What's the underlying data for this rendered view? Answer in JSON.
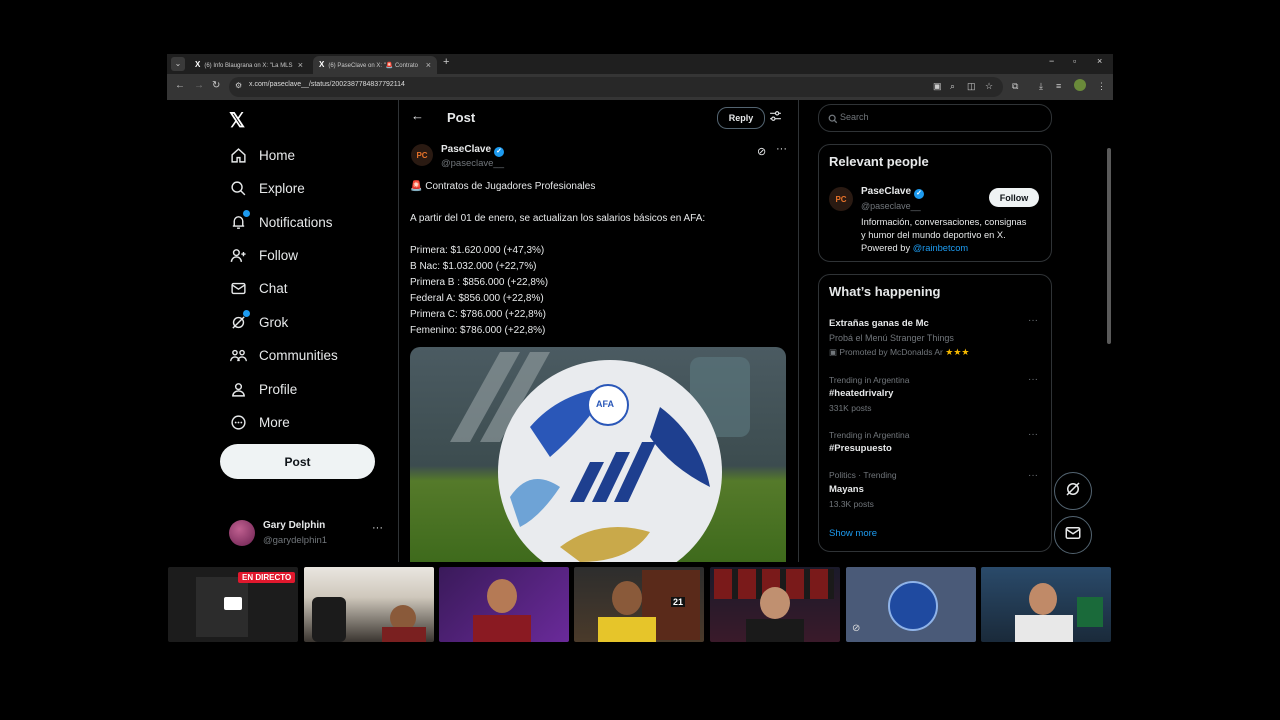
{
  "browser": {
    "tabs": [
      {
        "favicon": "X",
        "title": "(6) Info Blaugrana on X: \"La MLS",
        "close": "×"
      },
      {
        "favicon": "X",
        "title": "(6) PaseClave on X: \"🚨 Contrato",
        "close": "×"
      }
    ],
    "new_tab": "+",
    "window_controls": {
      "minimize": "−",
      "maximize": "▫",
      "close": "×"
    },
    "url": "x.com/paseclave__/status/2002387784837792114"
  },
  "sidebar": {
    "logo": "𝕏",
    "items": [
      {
        "label": "Home",
        "icon": "home-icon"
      },
      {
        "label": "Explore",
        "icon": "search-icon"
      },
      {
        "label": "Notifications",
        "icon": "bell-icon"
      },
      {
        "label": "Follow",
        "icon": "add-user-icon"
      },
      {
        "label": "Chat",
        "icon": "mail-icon"
      },
      {
        "label": "Grok",
        "icon": "grok-icon"
      },
      {
        "label": "Communities",
        "icon": "communities-icon"
      },
      {
        "label": "Profile",
        "icon": "person-icon"
      },
      {
        "label": "More",
        "icon": "more-circle-icon"
      }
    ],
    "post_button": "Post",
    "account": {
      "name": "Gary Delphin",
      "handle": "@garydelphin1",
      "more": "···"
    }
  },
  "main": {
    "header": {
      "back": "←",
      "title": "Post",
      "reply_button": "Reply"
    },
    "post": {
      "author_name": "PaseClave",
      "author_handle": "@paseclave__",
      "avatar_text": "PC",
      "more": "···",
      "lines": [
        "🚨 Contratos de Jugadores Profesionales",
        "A partir del 01 de enero, se actualizan los salarios básicos en AFA:",
        "Primera: $1.620.000 (+47,3%)",
        "B Nac: $1.032.000 (+22,7%)",
        "Primera B : $856.000 (+22,8%)",
        "Federal A: $856.000 (+22,8%)",
        "Primera C: $786.000 (+22,8%)",
        "Femenino: $786.000 (+22,8%)"
      ],
      "image_badge": "AFA"
    }
  },
  "right": {
    "search_placeholder": "Search",
    "relevant_people": {
      "title": "Relevant people",
      "name": "PaseClave",
      "handle": "@paseclave__",
      "follow": "Follow",
      "bio_lines": [
        "Información, conversaciones, consignas",
        "y humor del mundo deportivo en X."
      ],
      "bio_powered": "Powered by ",
      "bio_link": "@rainbetcom"
    },
    "whats_happening": {
      "title": "What’s happening",
      "trends": [
        {
          "name": "Extrañas ganas de Mc",
          "sub": "Probá el Menú Stranger Things",
          "promo": "Promoted by McDonalds Ar",
          "stars": "★★★"
        },
        {
          "context": "Trending in Argentina",
          "name": "#heatedrivalry",
          "count": "331K posts"
        },
        {
          "context": "Trending in Argentina",
          "name": "#Presupuesto"
        },
        {
          "context": "Politics · Trending",
          "name": "Mayans",
          "count": "13.3K posts"
        }
      ],
      "trend_more": "···",
      "show_more": "Show more"
    }
  },
  "video_strip": {
    "live_label": "EN DIRECTO",
    "jersey_number": "21"
  },
  "colors": {
    "accent": "#1d9bf0",
    "background": "#000000",
    "text": "#e7e9ea",
    "muted": "#71767b",
    "live": "#e0182d"
  }
}
